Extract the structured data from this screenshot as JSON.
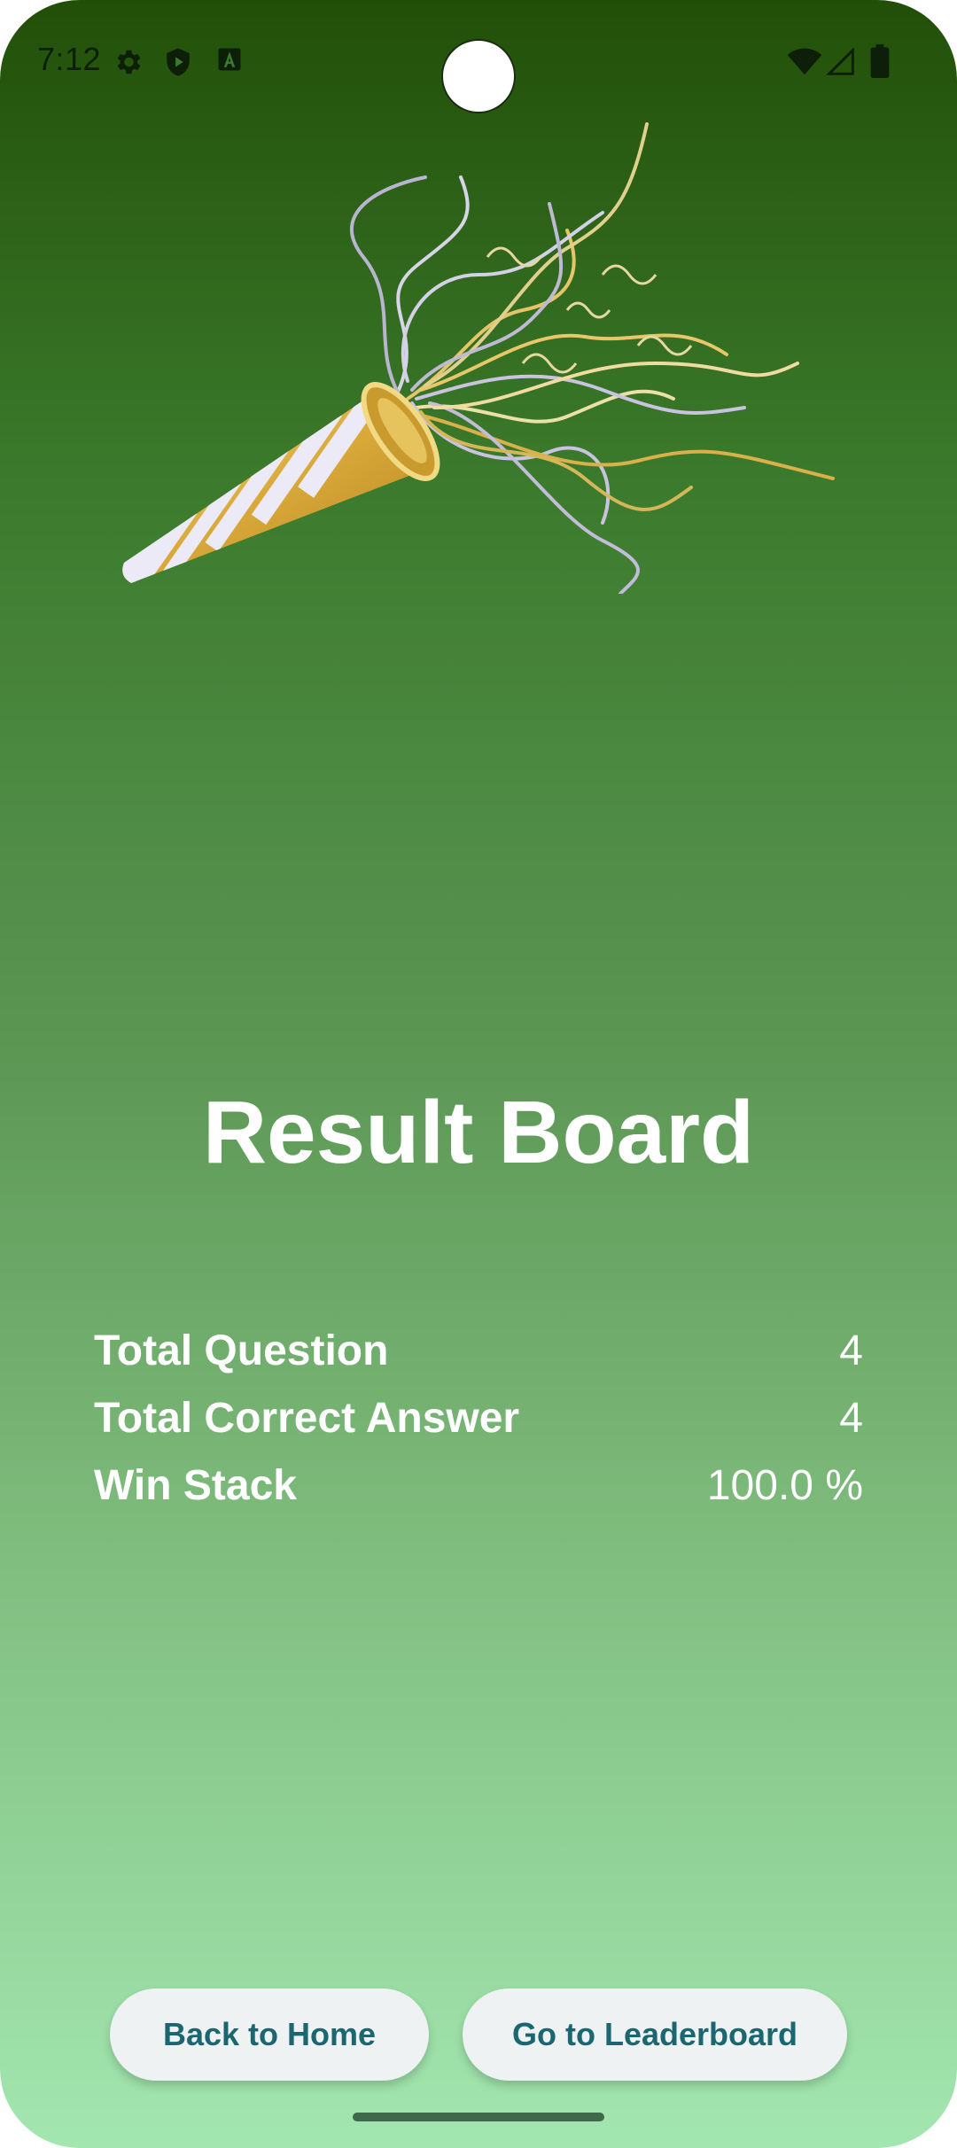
{
  "status_bar": {
    "time": "7:12",
    "left_icons": [
      "gear-icon",
      "shield-play-icon",
      "font-a-icon"
    ],
    "right_icons": [
      "wifi-icon",
      "cell-signal-icon",
      "battery-icon"
    ]
  },
  "hero": {
    "image": "party-popper-icon"
  },
  "title": "Result Board",
  "stats": [
    {
      "label": "Total Question",
      "value": "4"
    },
    {
      "label": "Total Correct Answer",
      "value": "4"
    },
    {
      "label": "Win Stack",
      "value": "100.0 %"
    }
  ],
  "buttons": {
    "home": "Back to Home",
    "leaderboard": "Go to Leaderboard"
  },
  "colors": {
    "gradient_top": "#224f08",
    "gradient_bottom": "#a3e6b0",
    "button_bg": "#eef2f3",
    "button_text": "#1b6670"
  }
}
